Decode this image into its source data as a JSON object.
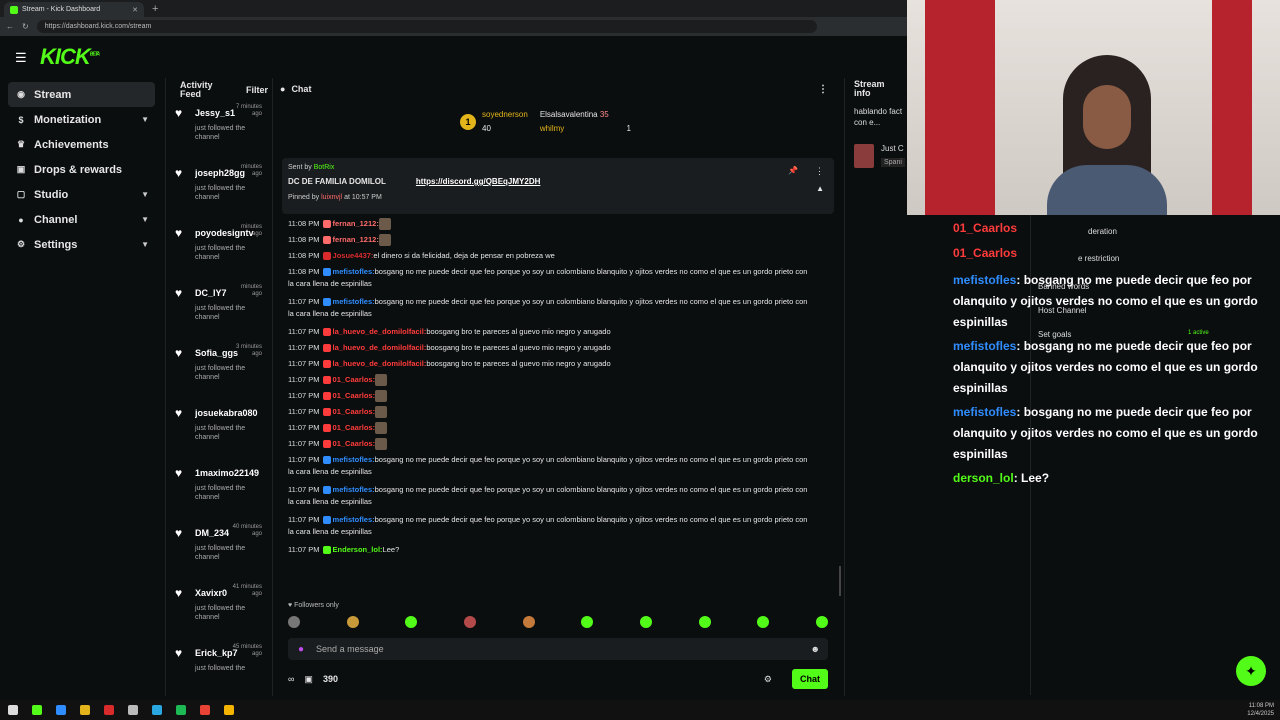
{
  "browser": {
    "tab_title": "Stream - Kick Dashboard",
    "url": "https://dashboard.kick.com/stream"
  },
  "header": {
    "logo_text": "KICK",
    "logo_sup": "BETA"
  },
  "sidebar": {
    "items": [
      {
        "label": "Stream",
        "icon": "broadcast-icon"
      },
      {
        "label": "Monetization",
        "icon": "dollar-icon"
      },
      {
        "label": "Achievements",
        "icon": "trophy-icon"
      },
      {
        "label": "Drops & rewards",
        "icon": "gift-icon"
      },
      {
        "label": "Studio",
        "icon": "studio-icon"
      },
      {
        "label": "Channel",
        "icon": "user-icon"
      },
      {
        "label": "Settings",
        "icon": "gear-icon"
      }
    ]
  },
  "activity": {
    "title": "Activity Feed",
    "filter_label": "Filter",
    "items": [
      {
        "name": "Jessy_s1",
        "ago": "7 minutes ago",
        "msg": "just followed the channel"
      },
      {
        "name": "joseph28gg",
        "ago": "minutes ago",
        "msg": "just followed the channel"
      },
      {
        "name": "poyodesigntv",
        "ago": "minutes ago",
        "msg": "just followed the channel"
      },
      {
        "name": "DC_IY7",
        "ago": "minutes ago",
        "msg": "just followed the channel"
      },
      {
        "name": "Sofia_ggs",
        "ago": "3 minutes ago",
        "msg": "just followed the channel"
      },
      {
        "name": "josuekabra080",
        "ago": "",
        "msg": "just followed the channel"
      },
      {
        "name": "1maximo221494",
        "ago": "",
        "msg": "just followed the channel"
      },
      {
        "name": "DM_234",
        "ago": "40 minutes ago",
        "msg": "just followed the channel"
      },
      {
        "name": "Xavixr0",
        "ago": "41 minutes ago",
        "msg": "just followed the channel"
      },
      {
        "name": "Erick_kp7",
        "ago": "45 minutes ago",
        "msg": "just followed the"
      }
    ]
  },
  "chat": {
    "title": "Chat",
    "gifters": [
      {
        "name": "soyednerson",
        "count": "40"
      },
      {
        "name": "Elsalsavalentina",
        "count": "35"
      },
      {
        "name": "whilmy",
        "count": "1"
      }
    ],
    "pinned": {
      "sent_by": "Sent by",
      "bot": "BotRix",
      "title": "DC DE FAMILIA DOMILOL",
      "link": "https://discord.gg/QBEqJMY2DH",
      "pinned_by_prefix": "Pinned by",
      "pinned_by_user": "luixnvjl",
      "pinned_time": "at 10:57 PM"
    },
    "messages": [
      {
        "time": "11:08 PM",
        "user": "fernan_1212:",
        "text": "",
        "color": "#ff6b6b"
      },
      {
        "time": "11:08 PM",
        "user": "fernan_1212:",
        "text": "",
        "color": "#ff6b6b"
      },
      {
        "time": "11:08 PM",
        "user": "Josue4437:",
        "text": "el dinero si da felicidad, deja de pensar en pobreza we",
        "color": "#d92b2b"
      },
      {
        "time": "11:08 PM",
        "user": "mefistofles:",
        "text": "bosgang no me puede decir que feo porque yo soy un colombiano blanquito y ojitos verdes no como el que es un gordo prieto con la cara llena de espinillas",
        "color": "#2f8dff"
      },
      {
        "time": "11:07 PM",
        "user": "mefistofles:",
        "text": "bosgang no me puede decir que feo porque yo soy un colombiano blanquito y ojitos verdes no como el que es un gordo prieto con la cara llena de espinillas",
        "color": "#2f8dff"
      },
      {
        "time": "11:07 PM",
        "user": "la_huevo_de_domilolfacil:",
        "text": "boosgang bro te pareces al guevo mio negro y arugado",
        "color": "#ff3b3b"
      },
      {
        "time": "11:07 PM",
        "user": "la_huevo_de_domilolfacil:",
        "text": "boosgang bro te pareces al guevo mio negro y arugado",
        "color": "#ff3b3b"
      },
      {
        "time": "11:07 PM",
        "user": "la_huevo_de_domilolfacil:",
        "text": "boosgang bro te pareces al guevo mio negro y arugado",
        "color": "#ff3b3b"
      },
      {
        "time": "11:07 PM",
        "user": "01_Caarlos:",
        "text": "",
        "color": "#ff3b3b"
      },
      {
        "time": "11:07 PM",
        "user": "01_Caarlos:",
        "text": "",
        "color": "#ff3b3b"
      },
      {
        "time": "11:07 PM",
        "user": "01_Caarlos:",
        "text": "",
        "color": "#ff3b3b"
      },
      {
        "time": "11:07 PM",
        "user": "01_Caarlos:",
        "text": "",
        "color": "#ff3b3b"
      },
      {
        "time": "11:07 PM",
        "user": "01_Caarlos:",
        "text": "",
        "color": "#ff3b3b"
      },
      {
        "time": "11:07 PM",
        "user": "mefistofles:",
        "text": "bosgang no me puede decir que feo porque yo soy un colombiano blanquito y ojitos verdes no como el que es un gordo prieto con la cara llena de espinillas",
        "color": "#2f8dff"
      },
      {
        "time": "11:07 PM",
        "user": "mefistofles:",
        "text": "bosgang no me puede decir que feo porque yo soy un colombiano blanquito y ojitos verdes no como el que es un gordo prieto con la cara llena de espinillas",
        "color": "#2f8dff"
      },
      {
        "time": "11:07 PM",
        "user": "mefistofles:",
        "text": "bosgang no me puede decir que feo porque yo soy un colombiano blanquito y ojitos verdes no como el que es un gordo prieto con la cara llena de espinillas",
        "color": "#2f8dff"
      },
      {
        "time": "11:07 PM",
        "user": "Enderson_lol:",
        "text": "Lee?",
        "color": "#53fc18"
      }
    ],
    "followers_only": "Followers only",
    "input_placeholder": "Send a message",
    "points": "390",
    "send_label": "Chat"
  },
  "stream_info": {
    "title": "Stream info",
    "desc": "hablando fact con e...",
    "category": "Just C",
    "language": "Spani"
  },
  "overlay": {
    "menu": [
      "deration",
      "e restriction",
      "Banned words",
      "Host Channel",
      "Set goals",
      "1 active"
    ],
    "messages": [
      {
        "user": "01_Caarlos",
        "text": "",
        "kind": "ca"
      },
      {
        "user": "01_Caarlos",
        "text": "",
        "kind": "ca"
      },
      {
        "user": "mefistofles",
        "text": ": bosgang no me puede decir que feo por",
        "kind": "me"
      },
      {
        "user": "",
        "text": "olanquito y ojitos verdes no como el que es un gordo",
        "kind": "me"
      },
      {
        "user": "",
        "text": "espinillas",
        "kind": "me"
      },
      {
        "user": "mefistofles",
        "text": ": bosgang no me puede decir que feo por",
        "kind": "me"
      },
      {
        "user": "",
        "text": "olanquito y ojitos verdes no como el que es un gordo",
        "kind": "me"
      },
      {
        "user": "",
        "text": "espinillas",
        "kind": "me"
      },
      {
        "user": "mefistofles",
        "text": ": bosgang no me puede decir que feo por",
        "kind": "me"
      },
      {
        "user": "",
        "text": "olanquito y ojitos verdes no como el que es un gordo",
        "kind": "me"
      },
      {
        "user": "",
        "text": "espinillas",
        "kind": "me"
      },
      {
        "user": "derson_lol",
        "text": ": Lee?",
        "kind": "en"
      }
    ]
  },
  "taskbar": {
    "time": "11:08 PM",
    "date": "12/4/2025"
  },
  "colors": {
    "brand": "#53fc18",
    "bg": "#0b0e0f"
  }
}
